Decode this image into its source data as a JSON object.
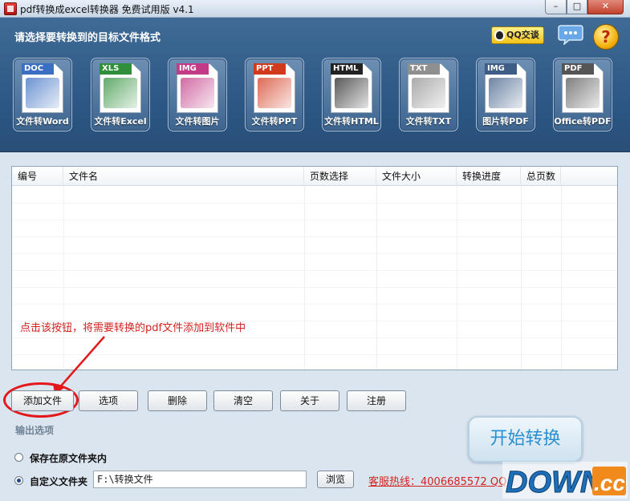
{
  "window": {
    "title": "pdf转换成excel转换器 免费试用版 v4.1",
    "min": "–",
    "max": "□",
    "close": "✕"
  },
  "header": {
    "title": "请选择要转换到的目标文件格式",
    "qq": "QQ交谈",
    "help": "?",
    "formats": [
      {
        "tag": "DOC",
        "label": "文件转Word",
        "color": "#3b6fc2",
        "icon": "word-doc-icon"
      },
      {
        "tag": "XLS",
        "label": "文件转Excel",
        "color": "#2f8f3a",
        "icon": "excel-chart-icon"
      },
      {
        "tag": "IMG",
        "label": "文件转图片",
        "color": "#c23b86",
        "icon": "image-icon"
      },
      {
        "tag": "PPT",
        "label": "文件转PPT",
        "color": "#d23a1e",
        "icon": "ppt-icon"
      },
      {
        "tag": "HTML",
        "label": "文件转HTML",
        "color": "#222222",
        "icon": "html-globe-icon"
      },
      {
        "tag": "TXT",
        "label": "文件转TXT",
        "color": "#8f8f8f",
        "icon": "txt-pen-icon"
      },
      {
        "tag": "IMG",
        "label": "图片转PDF",
        "color": "#3d5c86",
        "icon": "image-to-pdf-icon"
      },
      {
        "tag": "PDF",
        "label": "Office转PDF",
        "color": "#555555",
        "icon": "pdf-acrobat-icon"
      }
    ]
  },
  "table": {
    "columns": [
      "编号",
      "文件名",
      "页数选择",
      "文件大小",
      "转换进度",
      "总页数"
    ],
    "rows": []
  },
  "hint": "点击该按钮，将需要转换的pdf文件添加到软件中",
  "toolbar": {
    "add": "添加文件",
    "options": "选项",
    "delete": "删除",
    "clear": "清空",
    "about": "关于",
    "register": "注册"
  },
  "output": {
    "section": "输出选项",
    "opt_source": "保存在原文件夹内",
    "opt_custom": "自定义文件夹",
    "path": "F:\\转换文件",
    "browse": "浏览",
    "hotline": "客服热线：4006685572 QQ"
  },
  "start": "开始转换",
  "watermark": {
    "main": "DOWN",
    "suffix": ".cc"
  }
}
